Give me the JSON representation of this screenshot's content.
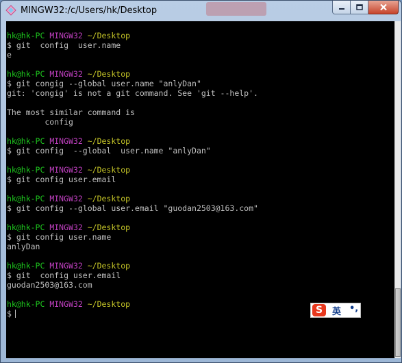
{
  "window": {
    "title": "MINGW32:/c/Users/hk/Desktop"
  },
  "terminal": {
    "lines": [
      [
        {
          "c": "g",
          "t": "hk@hk-PC"
        },
        {
          "c": "",
          "t": " "
        },
        {
          "c": "m",
          "t": "MINGW32"
        },
        {
          "c": "",
          "t": " "
        },
        {
          "c": "y",
          "t": "~/Desktop"
        }
      ],
      [
        {
          "c": "",
          "t": "$ git  config  user.name"
        }
      ],
      [
        {
          "c": "",
          "t": "e"
        }
      ],
      [],
      [
        {
          "c": "g",
          "t": "hk@hk-PC"
        },
        {
          "c": "",
          "t": " "
        },
        {
          "c": "m",
          "t": "MINGW32"
        },
        {
          "c": "",
          "t": " "
        },
        {
          "c": "y",
          "t": "~/Desktop"
        }
      ],
      [
        {
          "c": "",
          "t": "$ git congig --global user.name \"anlyDan\""
        }
      ],
      [
        {
          "c": "",
          "t": "git: 'congig' is not a git command. See 'git --help'."
        }
      ],
      [],
      [
        {
          "c": "",
          "t": "The most similar command is"
        }
      ],
      [
        {
          "c": "",
          "t": "        config"
        }
      ],
      [],
      [
        {
          "c": "g",
          "t": "hk@hk-PC"
        },
        {
          "c": "",
          "t": " "
        },
        {
          "c": "m",
          "t": "MINGW32"
        },
        {
          "c": "",
          "t": " "
        },
        {
          "c": "y",
          "t": "~/Desktop"
        }
      ],
      [
        {
          "c": "",
          "t": "$ git config  --global  user.name \"anlyDan\""
        }
      ],
      [],
      [
        {
          "c": "g",
          "t": "hk@hk-PC"
        },
        {
          "c": "",
          "t": " "
        },
        {
          "c": "m",
          "t": "MINGW32"
        },
        {
          "c": "",
          "t": " "
        },
        {
          "c": "y",
          "t": "~/Desktop"
        }
      ],
      [
        {
          "c": "",
          "t": "$ git config user.email"
        }
      ],
      [],
      [
        {
          "c": "g",
          "t": "hk@hk-PC"
        },
        {
          "c": "",
          "t": " "
        },
        {
          "c": "m",
          "t": "MINGW32"
        },
        {
          "c": "",
          "t": " "
        },
        {
          "c": "y",
          "t": "~/Desktop"
        }
      ],
      [
        {
          "c": "",
          "t": "$ git config --global user.email \"guodan2503@163.com\""
        }
      ],
      [],
      [
        {
          "c": "g",
          "t": "hk@hk-PC"
        },
        {
          "c": "",
          "t": " "
        },
        {
          "c": "m",
          "t": "MINGW32"
        },
        {
          "c": "",
          "t": " "
        },
        {
          "c": "y",
          "t": "~/Desktop"
        }
      ],
      [
        {
          "c": "",
          "t": "$ git config user.name"
        }
      ],
      [
        {
          "c": "",
          "t": "anlyDan"
        }
      ],
      [],
      [
        {
          "c": "g",
          "t": "hk@hk-PC"
        },
        {
          "c": "",
          "t": " "
        },
        {
          "c": "m",
          "t": "MINGW32"
        },
        {
          "c": "",
          "t": " "
        },
        {
          "c": "y",
          "t": "~/Desktop"
        }
      ],
      [
        {
          "c": "",
          "t": "$ git  config user.email"
        }
      ],
      [
        {
          "c": "",
          "t": "guodan2503@163.com"
        }
      ],
      [],
      [
        {
          "c": "g",
          "t": "hk@hk-PC"
        },
        {
          "c": "",
          "t": " "
        },
        {
          "c": "m",
          "t": "MINGW32"
        },
        {
          "c": "",
          "t": " "
        },
        {
          "c": "y",
          "t": "~/Desktop"
        }
      ]
    ],
    "prompt_symbol": "$"
  },
  "ime": {
    "logo": "S",
    "label": "英",
    "punct": "•,"
  },
  "colors": {
    "user_host": "#1ec61e",
    "shell_name": "#c040c0",
    "path": "#c8c828",
    "text": "#c0c0c0",
    "background": "#000000"
  },
  "icons": {
    "app": "mingw-diamond-icon",
    "minimize": "minimize-icon",
    "maximize": "maximize-icon",
    "close": "close-icon"
  }
}
